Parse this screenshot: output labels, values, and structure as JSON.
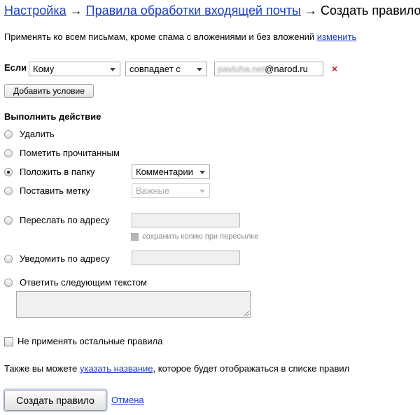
{
  "breadcrumb": {
    "settings": "Настройка",
    "arrow1": " → ",
    "rules": "Правила обработки входящей почты",
    "arrow2": " → ",
    "current": "Создать правило"
  },
  "apply": {
    "text": "Применять ко всем письмам, кроме спама с вложениями и без вложений ",
    "change_link": "изменить"
  },
  "condition": {
    "label": "Если",
    "field_select": "Кому",
    "operator_select": "совпадает с",
    "value_blurred": "pavluha.net",
    "value_domain": "@narod.ru",
    "remove_icon": "×",
    "add_button": "Добавить условие"
  },
  "action": {
    "title": "Выполнить действие",
    "delete": "Удалить",
    "mark_read": "Пометить прочитанным",
    "move_to_folder": "Положить в папку",
    "folder_select": "Комментарии",
    "set_label": "Поставить метку",
    "label_select": "Важные",
    "forward": "Переслать по адресу",
    "save_copy": "сохранить копию при пересылке",
    "notify": "Уведомить по адресу",
    "reply": "Ответить следующим текстом",
    "selected": "move_to_folder"
  },
  "no_other_rules": "Не применять остальные правила",
  "also": {
    "prefix": "Также вы можете ",
    "link": "указать название",
    "suffix": ", которое будет отображаться в списке правил"
  },
  "buttons": {
    "create": "Создать правило",
    "cancel": "Отмена"
  },
  "colors": {
    "link": "#1a3dc1",
    "remove": "#d02020",
    "disabled_field": "#f0f0f0"
  }
}
